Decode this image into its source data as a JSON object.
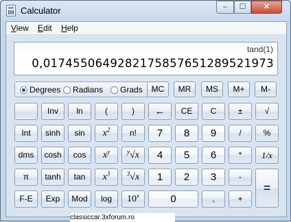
{
  "window": {
    "title": "Calculator",
    "min": "–",
    "max": "☐",
    "close": "✕"
  },
  "menu": [
    {
      "label": "View"
    },
    {
      "label": "Edit"
    },
    {
      "label": "Help"
    }
  ],
  "display": {
    "expression": "tand(1)",
    "value": "0,0174550649282175857651289521973"
  },
  "angle_modes": [
    {
      "label": "Degrees",
      "selected": true
    },
    {
      "label": "Radians",
      "selected": false
    },
    {
      "label": "Grads",
      "selected": false
    }
  ],
  "memory": [
    "MC",
    "MR",
    "MS",
    "M+",
    "M-"
  ],
  "rows": [
    [
      "",
      "Inv",
      "ln",
      "(",
      ")",
      "←",
      "CE",
      "C",
      "±",
      "√"
    ],
    [
      "Int",
      "sinh",
      "sin",
      "x²",
      "n!",
      "7",
      "8",
      "9",
      "/",
      "%"
    ],
    [
      "dms",
      "cosh",
      "cos",
      "xʸ",
      "ʸ√x",
      "4",
      "5",
      "6",
      "*",
      "1/x"
    ],
    [
      "π",
      "tanh",
      "tan",
      "x³",
      "³√x",
      "1",
      "2",
      "3",
      "-",
      "="
    ],
    [
      "F-E",
      "Exp",
      "Mod",
      "log",
      "10ˣ",
      "0",
      ",",
      "+"
    ]
  ],
  "math_labels": {
    "x2": {
      "base": "x",
      "sup": "2"
    },
    "xy": {
      "base": "x",
      "sup": "y"
    },
    "yroot": {
      "pre": "y",
      "root": "√",
      "base": "x"
    },
    "x3": {
      "base": "x",
      "sup": "3"
    },
    "root3": {
      "pre": "3",
      "root": "√",
      "base": "x"
    },
    "ten_x": {
      "base": "10",
      "sup": "x"
    }
  },
  "watermark": "classiccar.3xforum.ro"
}
